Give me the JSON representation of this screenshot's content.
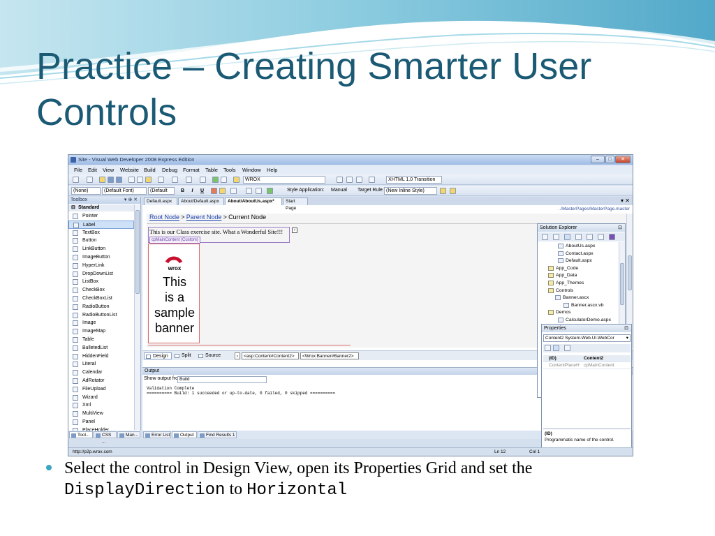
{
  "slide": {
    "title_line1": "Practice – Creating Smarter User",
    "title_line2": "Controls",
    "bullet": {
      "part1": "Select the control in Design View, open its Properties Grid and set the",
      "code1": "DisplayDirection",
      "part2": "to",
      "code2": "Horizontal"
    }
  },
  "window": {
    "title": "Site - Visual Web Developer 2008 Express Edition",
    "menu": [
      "File",
      "Edit",
      "View",
      "Website",
      "Build",
      "Debug",
      "Format",
      "Table",
      "Tools",
      "Window",
      "Help"
    ],
    "toolbar1": {
      "config_combo": "WROX",
      "doctype_combo": "XHTML 1.0 Transition"
    },
    "toolbar2": {
      "block_combo": "(None)",
      "font_combo": "(Default Font)",
      "size_combo": "(Default",
      "bold": "B",
      "italic": "I",
      "underline": "U",
      "style_app_label": "Style Application:",
      "style_app_value": "Manual",
      "target_rule_label": "Target Rule:",
      "target_rule_value": "(New Inline Style)"
    }
  },
  "toolbox": {
    "title": "Toolbox",
    "section": "Standard",
    "items": [
      "Pointer",
      "Label",
      "TextBox",
      "Button",
      "LinkButton",
      "ImageButton",
      "HyperLink",
      "DropDownList",
      "ListBox",
      "CheckBox",
      "CheckBoxList",
      "RadioButton",
      "RadioButtonList",
      "Image",
      "ImageMap",
      "Table",
      "BulletedList",
      "HiddenField",
      "Literal",
      "Calendar",
      "AdRotator",
      "FileUpload",
      "Wizard",
      "Xml",
      "MultiView",
      "Panel",
      "PlaceHolder"
    ],
    "bottom_tabs": [
      "Tool...",
      "CSS ...",
      "Man..."
    ]
  },
  "document": {
    "tabs": [
      "Default.aspx",
      "About/Default.aspx",
      "About/AboutUs.aspx*",
      "Start Page"
    ],
    "master_path": "../MasterPages/MasterPage.master",
    "breadcrumb": {
      "root": "Root Node",
      "sep": ">",
      "parent": "Parent Node",
      "current": "Current Node"
    },
    "banner_text": "This is our Class exercise site. What a Wonderful Site!!!",
    "content_label": "cpMainContent (Custom)",
    "logo_text": "wrox",
    "sample_lines": [
      "This",
      "is a",
      "sample",
      "banner"
    ],
    "view_tabs": [
      "Design",
      "Split",
      "Source"
    ],
    "tag_nav": [
      "<asp:Content#Content2>",
      "<Wrox:Banner#Banner2>"
    ]
  },
  "output": {
    "title": "Output",
    "show_label": "Show output from:",
    "show_value": "Build",
    "lines": [
      "Validation Complete",
      "========== Build: 1 succeeded or up-to-date, 0 failed, 0 skipped =========="
    ],
    "bottom_tabs": [
      "Error List",
      "Output",
      "Find Results 1"
    ]
  },
  "solution_explorer": {
    "title": "Solution Explorer",
    "items": [
      "AboutUs.aspx",
      "Contact.aspx",
      "Default.aspx",
      "App_Code",
      "App_Data",
      "App_Themes",
      "Controls",
      "Banner.ascx",
      "Banner.ascx.vb",
      "Demos",
      "CalculatorDemo.aspx"
    ]
  },
  "properties": {
    "title": "Properties",
    "object_combo": "Content2 System.Web.UI.WebCor",
    "header_row": {
      "name": "(ID)",
      "value": "Content2"
    },
    "row2": {
      "name": "ContentPlaceH",
      "value": "cpMainContent"
    },
    "desc_title": "(ID)",
    "desc_text": "Programmatic name of the control."
  },
  "status": {
    "url": "http://p2p.wrox.com",
    "ln": "Ln 12",
    "col": "Col 1"
  },
  "colors": {
    "title": "#1b5a74",
    "bullet": "#3aa6c4",
    "accent_blue": "#1a3fb0"
  }
}
